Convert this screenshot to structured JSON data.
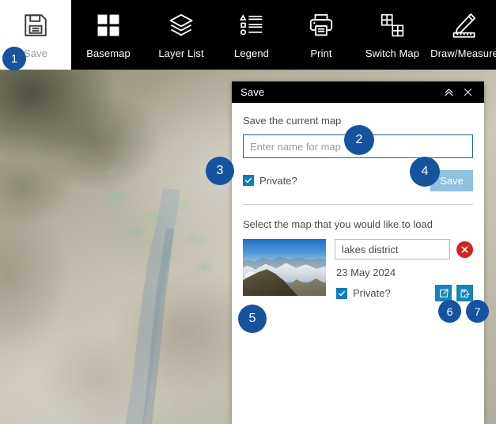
{
  "toolbar": {
    "items": [
      {
        "label": "Save",
        "icon": "floppy-disk-icon",
        "active": true
      },
      {
        "label": "Basemap",
        "icon": "grid-squares-icon",
        "active": false
      },
      {
        "label": "Layer List",
        "icon": "stacked-layers-icon",
        "active": false
      },
      {
        "label": "Legend",
        "icon": "legend-list-icon",
        "active": false
      },
      {
        "label": "Print",
        "icon": "printer-icon",
        "active": false
      },
      {
        "label": "Switch Map",
        "icon": "switch-map-icon",
        "active": false
      },
      {
        "label": "Draw/Measure",
        "icon": "pencil-ruler-icon",
        "active": false
      }
    ]
  },
  "panel": {
    "title": "Save",
    "collapse_icon": "chevron-double-up-icon",
    "close_icon": "close-x-icon",
    "save_section": {
      "label": "Save the current map",
      "input_placeholder": "Enter name for map",
      "input_value": "",
      "private_label": "Private?",
      "private_checked": true,
      "save_button_label": "Save"
    },
    "load_section": {
      "label": "Select the map that you would like to load",
      "thumbnail_alt": "mountain-panorama-thumbnail",
      "map_name": "lakes district",
      "map_date": "23 May 2024",
      "private_label": "Private?",
      "private_checked": true,
      "delete_icon": "delete-circle-x-icon",
      "share_icon": "share-export-icon",
      "update_icon": "update-map-icon"
    }
  },
  "badges": [
    {
      "number": "1"
    },
    {
      "number": "2"
    },
    {
      "number": "3"
    },
    {
      "number": "4"
    },
    {
      "number": "5"
    },
    {
      "number": "6"
    },
    {
      "number": "7"
    }
  ],
  "colors": {
    "badge_blue": "#15539f",
    "accent_blue": "#1682bd",
    "save_button_blue": "#8fc0e0",
    "delete_red": "#d8201f",
    "toolbar_black": "#000000"
  }
}
